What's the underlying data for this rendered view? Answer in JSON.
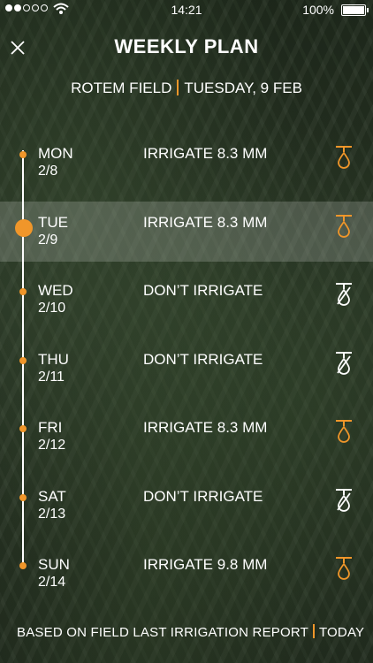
{
  "status_bar": {
    "time": "14:21",
    "battery": "100%"
  },
  "header": {
    "title": "WEEKLY PLAN",
    "field": "ROTEM FIELD",
    "date": "TUESDAY, 9 FEB"
  },
  "days": [
    {
      "day": "MON",
      "date": "2/8",
      "action": "IRRIGATE 8.3 MM",
      "icon": "drip-icon"
    },
    {
      "day": "TUE",
      "date": "2/9",
      "action": "IRRIGATE 8.3 MM",
      "icon": "drip-icon",
      "selected": true
    },
    {
      "day": "WED",
      "date": "2/10",
      "action": "DON’T IRRIGATE",
      "icon": "no-drip-icon"
    },
    {
      "day": "THU",
      "date": "2/11",
      "action": "DON’T IRRIGATE",
      "icon": "no-drip-icon"
    },
    {
      "day": "FRI",
      "date": "2/12",
      "action": "IRRIGATE 8.3 MM",
      "icon": "drip-icon"
    },
    {
      "day": "SAT",
      "date": "2/13",
      "action": "DON’T IRRIGATE",
      "icon": "no-drip-icon"
    },
    {
      "day": "SUN",
      "date": "2/14",
      "action": "IRRIGATE 9.8 MM",
      "icon": "drip-icon"
    }
  ],
  "footer": {
    "basis": "BASED ON FIELD LAST IRRIGATION REPORT",
    "when": "TODAY"
  },
  "colors": {
    "accent": "#f0962a",
    "text": "#ffffff"
  }
}
